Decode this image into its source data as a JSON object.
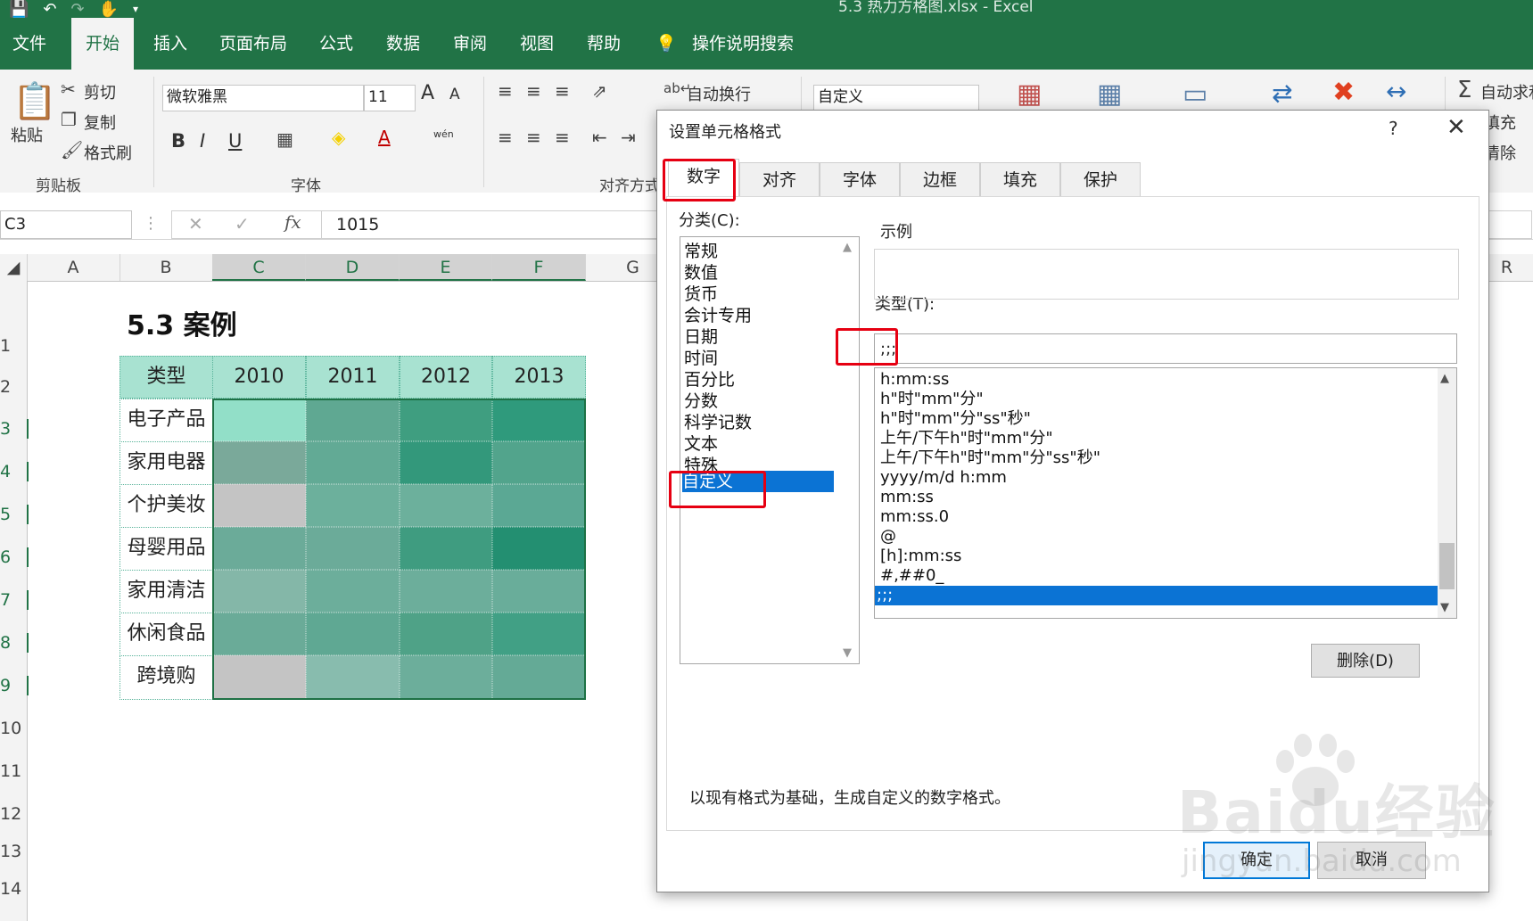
{
  "window": {
    "title": "5.3 热力方格图.xlsx  -  Excel"
  },
  "ribbon_tabs": [
    "文件",
    "开始",
    "插入",
    "页面布局",
    "公式",
    "数据",
    "审阅",
    "视图",
    "帮助"
  ],
  "ribbon_search": "操作说明搜索",
  "ribbon": {
    "paste": "粘贴",
    "cut": "剪切",
    "copy": "复制",
    "format_painter": "格式刷",
    "clipboard_group": "剪贴板",
    "font_name": "微软雅黑",
    "font_size": "11",
    "font_group": "字体",
    "bold": "B",
    "italic": "I",
    "underline": "U",
    "wrap_text": "自动换行",
    "align_group": "对齐方式",
    "number_format": "自定义",
    "autosum": "自动求和",
    "fill": "填充",
    "clear": "清除",
    "font_grow": "A",
    "font_shrink": "A",
    "phonetic": "wén"
  },
  "formula_bar": {
    "name_box": "C3",
    "fx": "fx",
    "value": "1015"
  },
  "grid": {
    "columns": [
      "A",
      "B",
      "C",
      "D",
      "E",
      "F",
      "G",
      "R"
    ],
    "rows": [
      "1",
      "2",
      "3",
      "4",
      "5",
      "6",
      "7",
      "8",
      "9",
      "10",
      "11",
      "12",
      "13",
      "14"
    ],
    "sheet_title": "5.3 案例",
    "table_header": [
      "类型",
      "2010",
      "2011",
      "2012",
      "2013"
    ],
    "table_rows": [
      "电子产品",
      "家用电器",
      "个护美妆",
      "母婴用品",
      "家用清洁",
      "休闲食品",
      "跨境购"
    ],
    "heat_colors": [
      [
        "#92dfc8",
        "#5fa892",
        "#3f9e80",
        "#2f9a7c"
      ],
      [
        "#7aa99a",
        "#62aa95",
        "#33987b",
        "#52a48c"
      ],
      [
        "#c4c4c4",
        "#6cb09c",
        "#6cb09c",
        "#5ba894"
      ],
      [
        "#6bab99",
        "#6bab99",
        "#3f9c80",
        "#238f71"
      ],
      [
        "#84b7a8",
        "#6cae9b",
        "#6cae9b",
        "#69ad9a"
      ],
      [
        "#6aab98",
        "#5fa893",
        "#4fa287",
        "#41a085"
      ],
      [
        "#c4c4c4",
        "#88bcae",
        "#6cae9b",
        "#64aa96"
      ]
    ]
  },
  "dialog": {
    "title": "设置单元格格式",
    "help": "?",
    "close": "✕",
    "tabs": [
      "数字",
      "对齐",
      "字体",
      "边框",
      "填充",
      "保护"
    ],
    "category_label": "分类(C):",
    "categories": [
      "常规",
      "数值",
      "货币",
      "会计专用",
      "日期",
      "时间",
      "百分比",
      "分数",
      "科学记数",
      "文本",
      "特殊",
      "自定义"
    ],
    "sample_label": "示例",
    "type_label": "类型(T):",
    "type_value": ";;;",
    "formats": [
      "h:mm:ss",
      "h\"时\"mm\"分\"",
      "h\"时\"mm\"分\"ss\"秒\"",
      "上午/下午h\"时\"mm\"分\"",
      "上午/下午h\"时\"mm\"分\"ss\"秒\"",
      "yyyy/m/d h:mm",
      "mm:ss",
      "mm:ss.0",
      "@",
      "[h]:mm:ss",
      "#,##0_",
      ";;;"
    ],
    "delete_button": "删除(D)",
    "description": "以现有格式为基础，生成自定义的数字格式。",
    "ok_button": "确定",
    "cancel_button": "取消"
  },
  "watermark": {
    "brand": "Baidu经验",
    "url": "jingyan.baidu.com"
  }
}
